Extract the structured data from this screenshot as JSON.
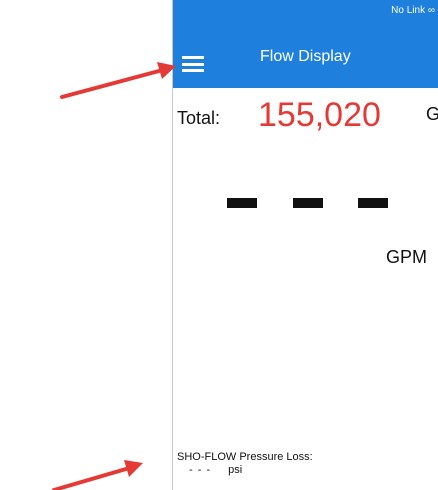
{
  "status_bar": {
    "text": "No Link ∞"
  },
  "app_bar": {
    "title": "Flow Display"
  },
  "total": {
    "label": "Total:",
    "value": "155,020",
    "unit": "G"
  },
  "flow": {
    "value": "- - -",
    "unit": "GPM"
  },
  "pressure_loss": {
    "label": "SHO-FLOW Pressure Loss:",
    "value": "- - -",
    "unit": "psi"
  },
  "colors": {
    "app_bar": "#1e80dc",
    "total_value": "#e53935",
    "annotation_arrow": "#e53935"
  },
  "icons": {
    "menu": "menu-icon",
    "link_status": "infinity-icon"
  }
}
